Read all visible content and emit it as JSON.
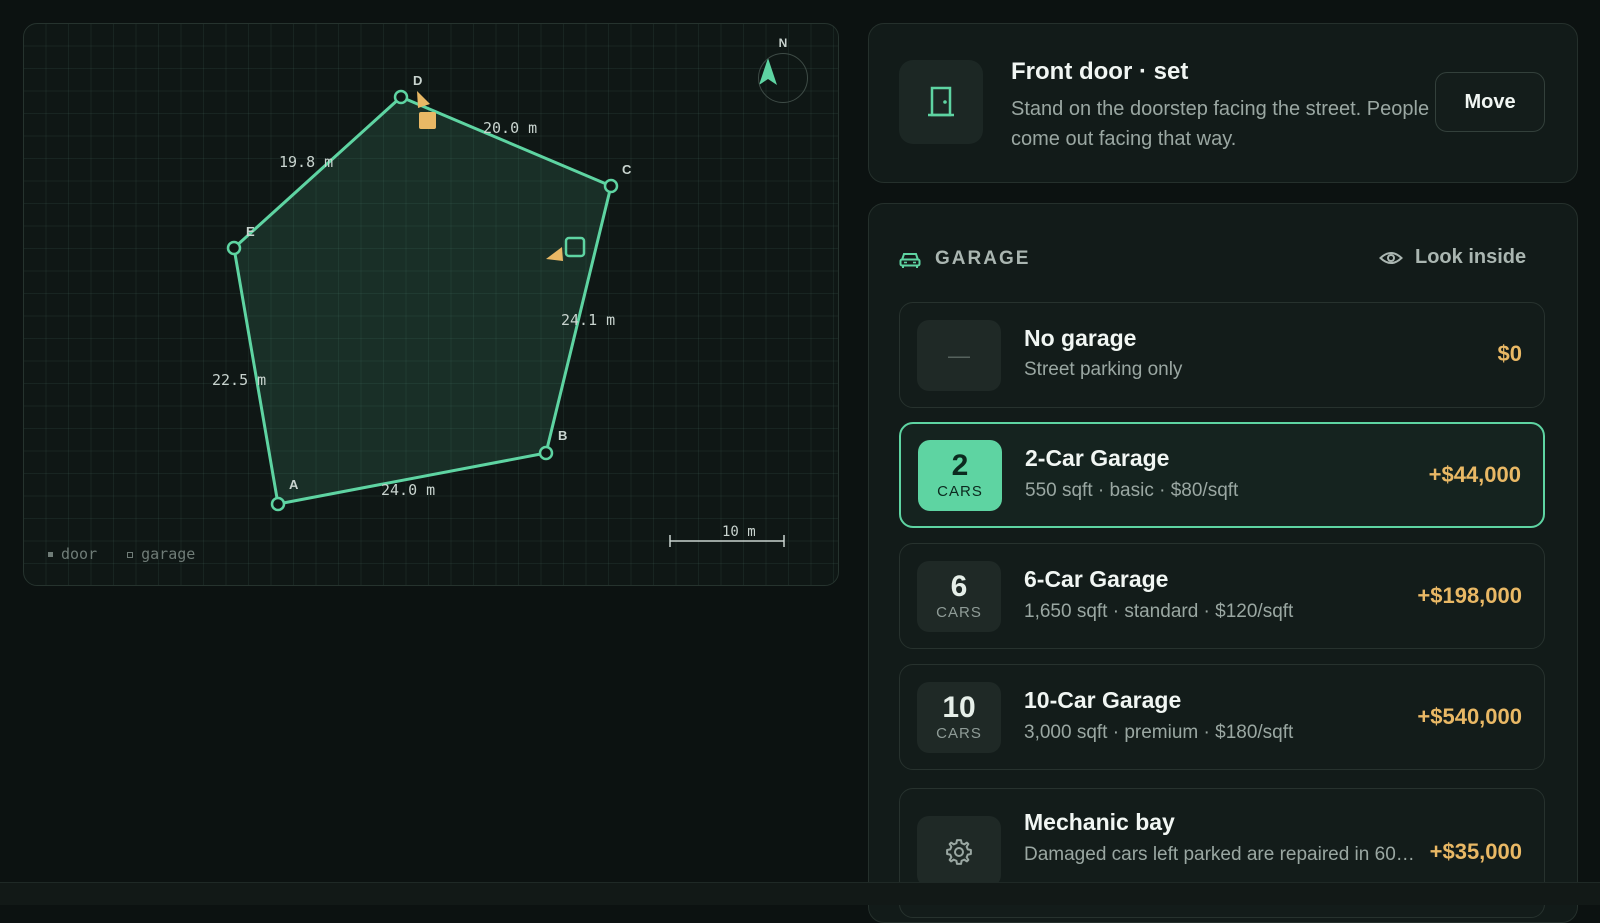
{
  "map": {
    "vertices": [
      {
        "id": "A",
        "label": "A"
      },
      {
        "id": "B",
        "label": "B"
      },
      {
        "id": "C",
        "label": "C"
      },
      {
        "id": "D",
        "label": "D"
      },
      {
        "id": "E",
        "label": "E"
      }
    ],
    "edges": [
      {
        "from": "A",
        "to": "B",
        "length": "24.0 m"
      },
      {
        "from": "B",
        "to": "C",
        "length": "24.1 m"
      },
      {
        "from": "C",
        "to": "D",
        "length": "20.0 m"
      },
      {
        "from": "D",
        "to": "E",
        "length": "19.8 m"
      },
      {
        "from": "E",
        "to": "A",
        "length": "22.5 m"
      }
    ],
    "compass_label": "N",
    "legend": {
      "door": "door",
      "garage": "garage"
    },
    "scale_label": "10 m",
    "colors": {
      "outline": "#5ed4a2",
      "marker": "#e9b865"
    }
  },
  "front_door": {
    "title": "Front door · set",
    "description": "Stand on the doorstep facing the street. People come out facing that way.",
    "move_label": "Move",
    "icon": "door-icon"
  },
  "garage": {
    "heading": "GARAGE",
    "look_inside_label": "Look inside",
    "options": [
      {
        "badge": "—",
        "unit": "",
        "title": "No garage",
        "subtitle": "Street parking only",
        "price": "$0",
        "selected": false
      },
      {
        "badge": "2",
        "unit": "CARS",
        "title": "2-Car Garage",
        "subtitle": "550 sqft · basic · $80/sqft",
        "price": "+$44,000",
        "selected": true
      },
      {
        "badge": "6",
        "unit": "CARS",
        "title": "6-Car Garage",
        "subtitle": "1,650 sqft · standard · $120/sqft",
        "price": "+$198,000",
        "selected": false
      },
      {
        "badge": "10",
        "unit": "CARS",
        "title": "10-Car Garage",
        "subtitle": "3,000 sqft · premium · $180/sqft",
        "price": "+$540,000",
        "selected": false
      },
      {
        "badge": "gear-icon",
        "unit": "",
        "title": "Mechanic bay",
        "subtitle": "Damaged cars left parked are repaired in 60…",
        "price": "+$35,000",
        "selected": false
      }
    ]
  }
}
